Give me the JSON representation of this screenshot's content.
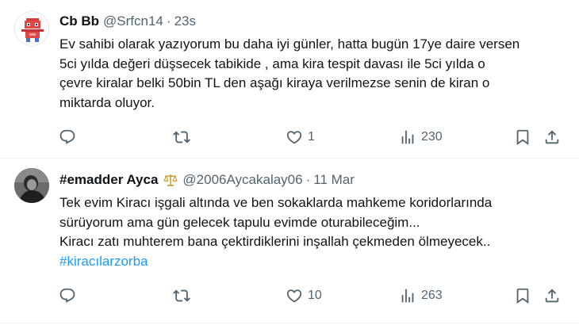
{
  "tweets": [
    {
      "name": "Cb Bb",
      "handle": "@Srfcn14",
      "separator": "·",
      "time": "23s",
      "lines": [
        "Ev sahibi olarak yazıyorum bu daha iyi günler, hatta bugün 17ye daire versen",
        "5ci yılda değeri düşsecek tabikide , ama kira tespit davası ile 5ci yılda o",
        "çevre kiralar belki 50bin TL den aşağı kiraya verilmezse senin de kiran o",
        "miktarda oluyor."
      ],
      "replies": "",
      "retweets": "",
      "likes": "1",
      "views": "230",
      "avatar_icon": "robot-avatar-icon"
    },
    {
      "name": "#emadder Ayca",
      "badge_icon": "scales-icon",
      "handle": "@2006Aycakalay06",
      "separator": "·",
      "time": "11 Mar",
      "lines": [
        "Tek evim Kiracı işgali altında ve ben sokaklarda mahkeme koridorlarında",
        "sürüyorum ama gün gelecek tapulu evimde oturabileceğim...",
        "Kiracı zatı muhterem bana çektirdiklerini inşallah çekmeden ölmeyecek.."
      ],
      "hashtag": "#kiracılarzorba",
      "replies": "",
      "retweets": "",
      "likes": "10",
      "views": "263",
      "avatar_icon": "profile-photo-icon"
    }
  ],
  "colors": {
    "text": "#0f1419",
    "muted": "#536471",
    "link": "#1d9bf0",
    "divider": "#eff3f4"
  }
}
